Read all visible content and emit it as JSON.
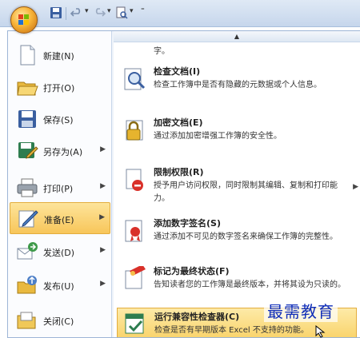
{
  "left_menu": {
    "items": [
      {
        "label": "新建(N)",
        "icon": "new-document-icon",
        "arrow": ""
      },
      {
        "label": "打开(O)",
        "icon": "open-folder-icon",
        "arrow": ""
      },
      {
        "label": "保存(S)",
        "icon": "save-disk-icon",
        "arrow": ""
      },
      {
        "label": "另存为(A)",
        "icon": "save-as-icon",
        "arrow": "▶"
      },
      {
        "label": "打印(P)",
        "icon": "printer-icon",
        "arrow": "▶"
      },
      {
        "label": "准备(E)",
        "icon": "prepare-icon",
        "arrow": "▶"
      },
      {
        "label": "发送(D)",
        "icon": "send-icon",
        "arrow": "▶"
      },
      {
        "label": "发布(U)",
        "icon": "publish-icon",
        "arrow": "▶"
      },
      {
        "label": "关闭(C)",
        "icon": "close-folder-icon",
        "arrow": ""
      }
    ]
  },
  "right_pane": {
    "scroll_up": "▲",
    "partial_text": "字。",
    "items": [
      {
        "title": "检查文档(I)",
        "desc": "检查工作簿中是否有隐藏的元数据或个人信息。",
        "icon": "inspect-document-icon"
      },
      {
        "title": "加密文档(E)",
        "desc": "通过添加加密增强工作簿的安全性。",
        "icon": "encrypt-lock-icon"
      },
      {
        "title": "限制权限(R)",
        "desc": "授予用户访问权限，同时限制其编辑、复制和打印能力。",
        "icon": "restrict-permission-icon",
        "arrow": "▶"
      },
      {
        "title": "添加数字签名(S)",
        "desc": "通过添加不可见的数字签名来确保工作簿的完整性。",
        "icon": "digital-signature-icon"
      },
      {
        "title": "标记为最终状态(F)",
        "desc": "告知读者您的工作簿是最终版本，并将其设为只读的。",
        "icon": "mark-final-icon"
      },
      {
        "title": "运行兼容性检查器(C)",
        "desc": "检查是否有早期版本 Excel 不支持的功能。",
        "icon": "compatibility-checker-icon"
      }
    ]
  },
  "watermark": "最需教育"
}
